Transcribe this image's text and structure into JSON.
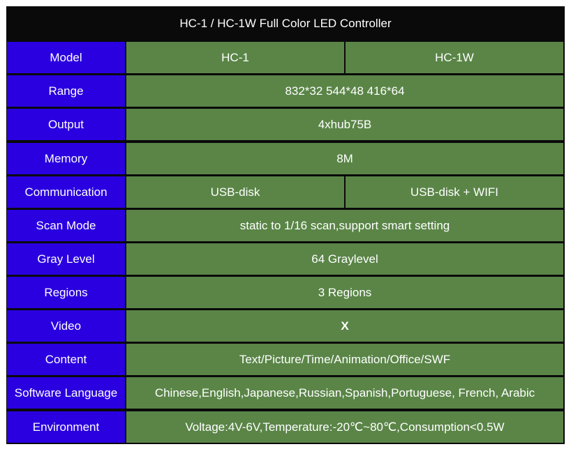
{
  "colors": {
    "header_bg": "#0a0a0a",
    "label_bg": "#2a00e0",
    "value_bg": "#5a8547",
    "border": "#0a0a0a",
    "text": "#ffffff"
  },
  "table": {
    "title": "HC-1 / HC-1W Full Color LED Controller",
    "rows": [
      {
        "label": "Model",
        "values": [
          "HC-1",
          "HC-1W"
        ]
      },
      {
        "label": "Range",
        "values": [
          "832*32  544*48  416*64"
        ]
      },
      {
        "label": "Output",
        "values": [
          "4xhub75B"
        ]
      },
      {
        "label": "Memory",
        "values": [
          "8M"
        ]
      },
      {
        "label": "Communication",
        "values": [
          "USB-disk",
          "USB-disk + WIFI"
        ]
      },
      {
        "label": "Scan Mode",
        "values": [
          "static to 1/16 scan,support smart setting"
        ]
      },
      {
        "label": "Gray Level",
        "values": [
          "64 Graylevel"
        ]
      },
      {
        "label": "Regions",
        "values": [
          "3 Regions"
        ]
      },
      {
        "label": "Video",
        "values": [
          "X"
        ],
        "bold": true
      },
      {
        "label": "Content",
        "values": [
          "Text/Picture/Time/Animation/Office/SWF"
        ]
      },
      {
        "label": "Software Language",
        "values": [
          "Chinese,English,Japanese,Russian,Spanish,Portuguese, French, Arabic"
        ]
      },
      {
        "label": "Environment",
        "values": [
          "Voltage:4V-6V,Temperature:-20℃~80℃,Consumption<0.5W"
        ]
      }
    ]
  }
}
